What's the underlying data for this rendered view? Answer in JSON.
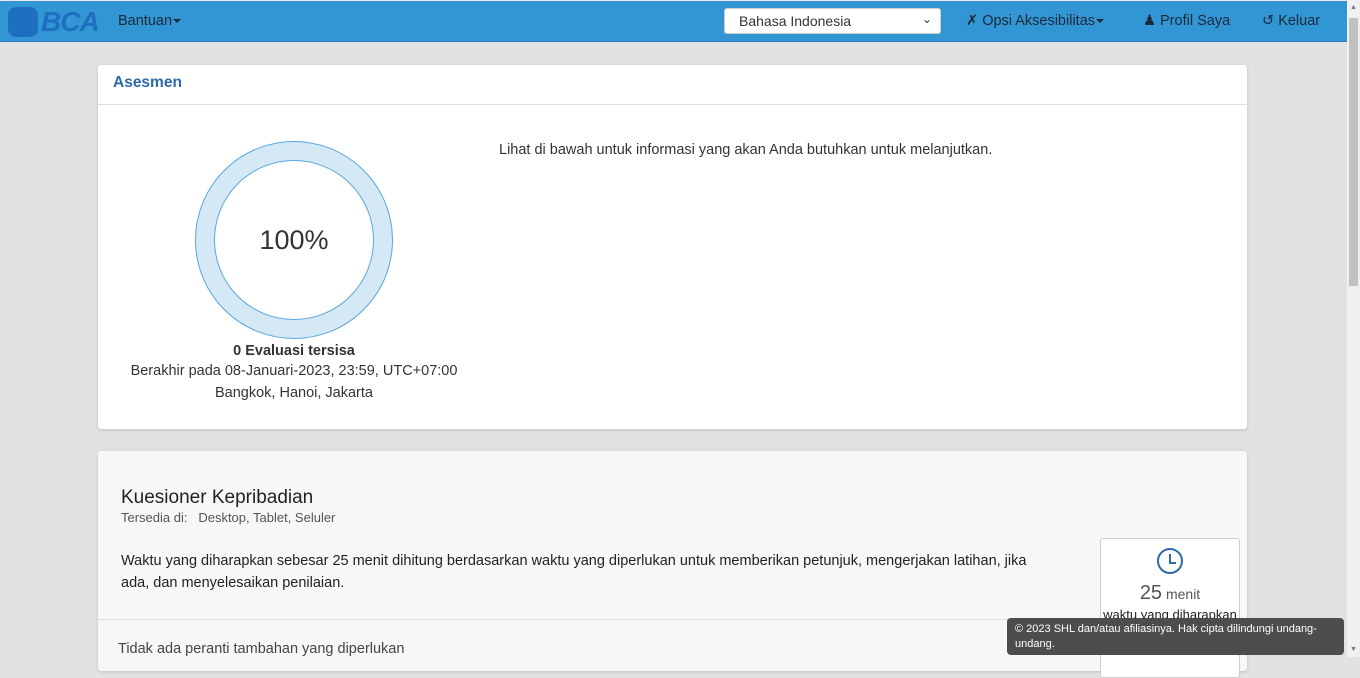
{
  "nav": {
    "logo": "BCA",
    "help": "Bantuan",
    "language": "Bahasa Indonesia",
    "accessibility": "Opsi Aksesibilitas",
    "profile": "Profil Saya",
    "logout": "Keluar"
  },
  "assessment": {
    "title": "Asesmen",
    "progress_label": "100%",
    "progress_percent": 100,
    "remaining": "0 Evaluasi tersisa",
    "deadline": "Berakhir pada 08-Januari-2023, 23:59, UTC+07:00",
    "timezone": "Bangkok, Hanoi, Jakarta",
    "intro": "Lihat di bawah untuk informasi yang akan Anda butuhkan untuk melanjutkan."
  },
  "questionnaire": {
    "title": "Kuesioner Kepribadian",
    "available_label": "Tersedia di:",
    "available_value": "Desktop, Tablet, Seluler",
    "description": "Waktu yang diharapkan sebesar 25 menit dihitung berdasarkan waktu yang diperlukan untuk memberikan petunjuk, mengerjakan latihan, jika ada, dan menyelesaikan penilaian.",
    "tools": "Tidak ada peranti tambahan yang diperlukan",
    "time_value": "25",
    "time_unit": "menit",
    "time_label": "waktu yang diharapkan"
  },
  "footer": "© 2023 SHL dan/atau afiliasinya. Hak cipta dilindungi undang-undang."
}
